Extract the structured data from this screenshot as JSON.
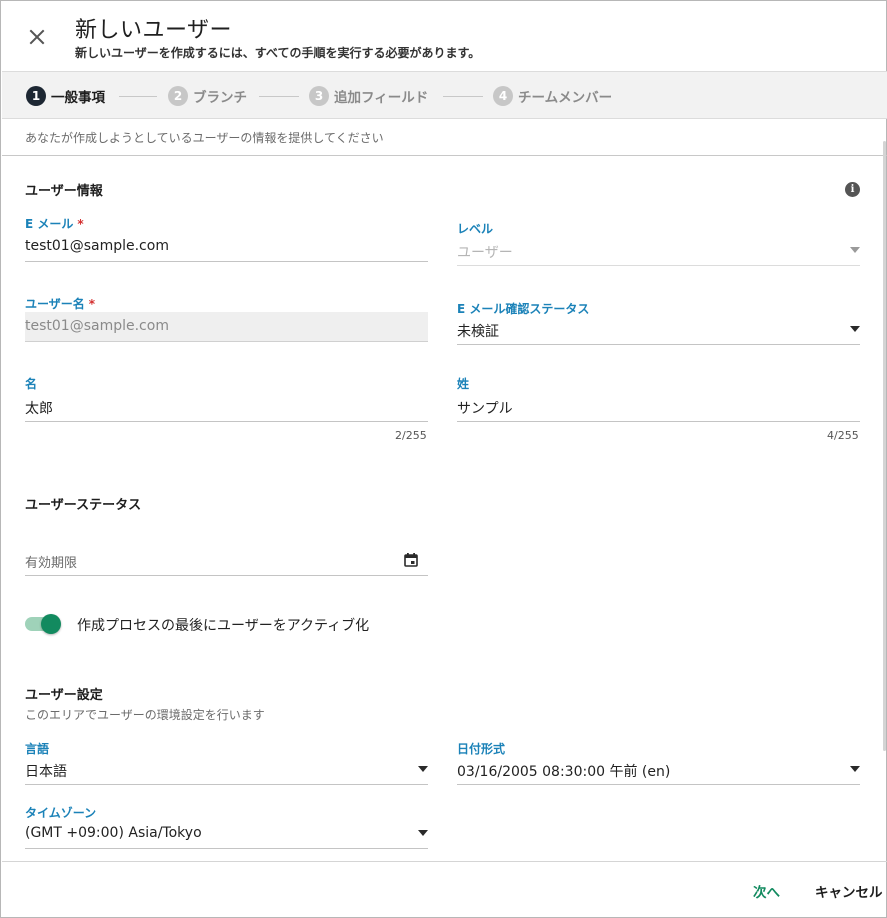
{
  "dialog": {
    "title": "新しいユーザー",
    "subtitle": "新しいユーザーを作成するには、すべての手順を実行する必要があります。"
  },
  "stepper": [
    {
      "number": "1",
      "label": "一般事項",
      "active": true
    },
    {
      "number": "2",
      "label": "ブランチ",
      "active": false
    },
    {
      "number": "3",
      "label": "追加フィールド",
      "active": false
    },
    {
      "number": "4",
      "label": "チームメンバー",
      "active": false
    }
  ],
  "description": "あなたが作成しようとしているユーザーの情報を提供してください",
  "user_info": {
    "title": "ユーザー情報",
    "email": {
      "label": "E メール",
      "required_mark": "*",
      "value": "test01@sample.com"
    },
    "level": {
      "label": "レベル",
      "placeholder": "ユーザー"
    },
    "username": {
      "label": "ユーザー名",
      "required_mark": "*",
      "value": "test01@sample.com"
    },
    "email_status": {
      "label": "E メール確認ステータス",
      "value": "未検証"
    },
    "first_name": {
      "label": "名",
      "value": "太郎",
      "counter": "2/255"
    },
    "last_name": {
      "label": "姓",
      "value": "サンプル",
      "counter": "4/255"
    }
  },
  "user_status": {
    "title": "ユーザーステータス",
    "expiry": {
      "placeholder": "有効期限"
    },
    "activate_toggle": {
      "label": "作成プロセスの最後にユーザーをアクティブ化",
      "on": true
    }
  },
  "user_settings": {
    "title": "ユーザー設定",
    "subtitle": "このエリアでユーザーの環境設定を行います",
    "language": {
      "label": "言語",
      "value": "日本語"
    },
    "date_format": {
      "label": "日付形式",
      "value": "03/16/2005 08:30:00 午前 (en)"
    },
    "timezone": {
      "label": "タイムゾーン",
      "value": "(GMT +09:00) Asia/Tokyo"
    }
  },
  "footer": {
    "next_label": "次へ",
    "cancel_label": "キャンセル"
  },
  "colors": {
    "accent_green": "#128a5f",
    "label_blue": "#1b82b8",
    "required_red": "#d32f2f",
    "active_step": "#1d2733"
  },
  "icons": [
    "close-icon",
    "info-icon",
    "calendar-icon",
    "chevron-down-icon"
  ]
}
